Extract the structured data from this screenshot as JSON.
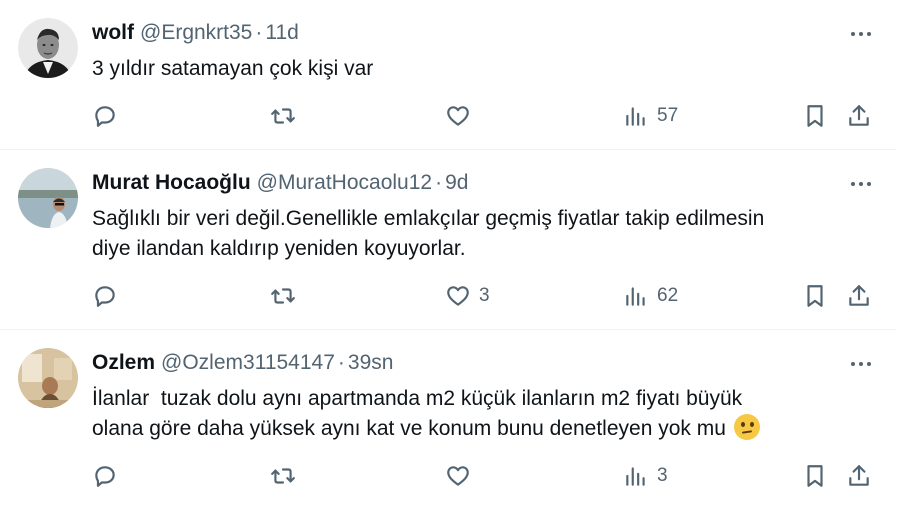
{
  "tweets": [
    {
      "name": "wolf",
      "handle": "@Ergnkrt35",
      "separator": "·",
      "time": "11d",
      "text_lines": [
        "3 yıldır satamayan çok kişi var"
      ],
      "replies": "",
      "retweets": "",
      "likes": "",
      "views": "57",
      "avatar_icon": "bw-portrait-man-avatar"
    },
    {
      "name": "Murat Hocaoğlu",
      "handle": "@MuratHocaolu12",
      "separator": "·",
      "time": "9d",
      "text_lines": [
        "Sağlıklı bir veri değil.Genellikle emlakçılar geçmiş fiyatlar takip edilmesin",
        "diye ilandan kaldırıp yeniden koyuyorlar."
      ],
      "replies": "",
      "retweets": "",
      "likes": "3",
      "views": "62",
      "avatar_icon": "lakeside-photo-avatar"
    },
    {
      "name": "Ozlem",
      "handle": "@Ozlem31154147",
      "separator": "·",
      "time": "39sn",
      "text_lines": [
        "İlanlar  tuzak dolu aynı apartmanda m2 küçük ilanların m2 fiyatı büyük",
        "olana göre daha yüksek aynı kat ve konum bunu denetleyen yok mu"
      ],
      "emoji": "confused-face-emoji",
      "replies": "",
      "retweets": "",
      "likes": "",
      "views": "3",
      "avatar_icon": "sepia-photo-avatar"
    }
  ]
}
